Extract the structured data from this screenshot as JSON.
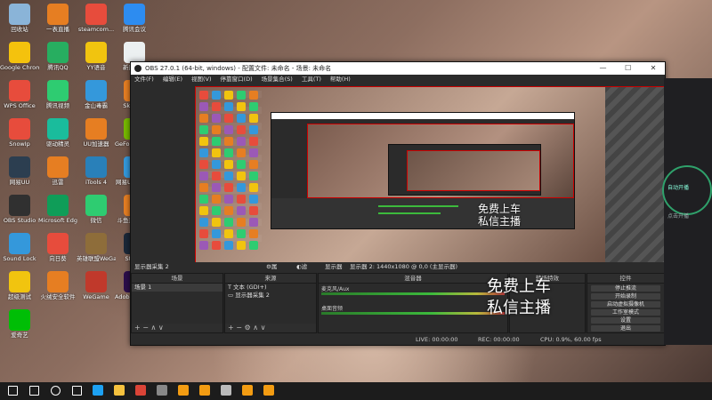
{
  "desktop_icons": [
    {
      "label": "回收站",
      "icon": "recycle-bin-icon",
      "color": "#8ab4d8"
    },
    {
      "label": "一表直播",
      "icon": "app-icon",
      "color": "#e67e22"
    },
    {
      "label": "steamcom...",
      "icon": "steam-icon",
      "color": "#e74c3c"
    },
    {
      "label": "腾讯会议",
      "icon": "meeting-icon",
      "color": "#2d8cf0"
    },
    {
      "label": "Google Chrome",
      "icon": "chrome-icon",
      "color": "#f4c20d"
    },
    {
      "label": "腾讯QQ",
      "icon": "qq-icon",
      "color": "#27ae60"
    },
    {
      "label": "YY语音",
      "icon": "yy-icon",
      "color": "#f1c40f"
    },
    {
      "label": "新建文本",
      "icon": "file-icon",
      "color": "#ecf0f1"
    },
    {
      "label": "WPS Office",
      "icon": "wps-icon",
      "color": "#e74c3c"
    },
    {
      "label": "腾讯视频",
      "icon": "video-icon",
      "color": "#2ecc71"
    },
    {
      "label": "金山毒霸",
      "icon": "security-icon",
      "color": "#3498db"
    },
    {
      "label": "SkyDisk",
      "icon": "app-icon",
      "color": "#e67e22"
    },
    {
      "label": "SnowIp",
      "icon": "app-icon",
      "color": "#e74c3c"
    },
    {
      "label": "驱动精灵",
      "icon": "app-icon",
      "color": "#1abc9c"
    },
    {
      "label": "UU加速器",
      "icon": "app-icon",
      "color": "#e67e22"
    },
    {
      "label": "GeForce Experience",
      "icon": "nvidia-icon",
      "color": "#76b900"
    },
    {
      "label": "网易UU",
      "icon": "app-icon",
      "color": "#2c3e50"
    },
    {
      "label": "迅雷",
      "icon": "app-icon",
      "color": "#e67e22"
    },
    {
      "label": "iTools 4",
      "icon": "itools-icon",
      "color": "#2980b9"
    },
    {
      "label": "网易UU加速器",
      "icon": "app-icon",
      "color": "#3498db"
    },
    {
      "label": "OBS Studio",
      "icon": "obs-icon",
      "color": "#303030"
    },
    {
      "label": "Microsoft Edge",
      "icon": "edge-icon",
      "color": "#0f9d58"
    },
    {
      "label": "微信",
      "icon": "wechat-icon",
      "color": "#2ecc71"
    },
    {
      "label": "斗鱼直播伴侣",
      "icon": "app-icon",
      "color": "#e67e22"
    },
    {
      "label": "Sound Lock",
      "icon": "lock-icon",
      "color": "#3498db"
    },
    {
      "label": "向日葵",
      "icon": "app-icon",
      "color": "#e74c3c"
    },
    {
      "label": "英雄联盟WeGame版",
      "icon": "game-icon",
      "color": "#8e6d3a"
    },
    {
      "label": "Steam",
      "icon": "steam-icon",
      "color": "#1b2838"
    },
    {
      "label": "超级测试",
      "icon": "app-icon",
      "color": "#f1c40f"
    },
    {
      "label": "火绒安全软件",
      "icon": "shield-icon",
      "color": "#e67e22"
    },
    {
      "label": "WeGame",
      "icon": "wegame-icon",
      "color": "#c0392b"
    },
    {
      "label": "Adobe Premie...",
      "icon": "premiere-icon",
      "color": "#2c0e4a"
    },
    {
      "label": "爱奇艺",
      "icon": "iqiyi-icon",
      "color": "#00be06"
    }
  ],
  "obs": {
    "title": "OBS 27.0.1 (64-bit, windows) - 配置文件: 未命名 - 场景: 未命名",
    "menu": [
      "文件(F)",
      "编辑(E)",
      "视图(V)",
      "停靠窗口(D)",
      "场景集合(S)",
      "工具(T)",
      "帮助(H)"
    ],
    "info_bar": {
      "source": "显示器采集 2",
      "properties": "属性",
      "filters": "滤镜",
      "display_label": "显示器",
      "display_value": "显示器 2: 1440x1080 @ 0,0 (主显示器)"
    },
    "docks": {
      "scenes": {
        "title": "场景",
        "items": [
          "场景 1"
        ]
      },
      "sources": {
        "title": "来源",
        "items": [
          "文本 (GDI+)",
          "显示器采集 2"
        ]
      },
      "mixer": {
        "title": "混音器",
        "tracks": [
          {
            "name": "桌面音频",
            "value": "0.0 dB"
          },
          {
            "name": "麦克风/Aux",
            "value": "0.0 dB"
          }
        ]
      },
      "transitions": {
        "title": "转场特效",
        "type": "淡出",
        "duration_label": "时长",
        "duration": "300 ms"
      },
      "controls": {
        "title": "控件",
        "buttons": [
          "停止推流",
          "开始录制",
          "启动虚拟摄像机",
          "工作室模式",
          "设置",
          "退出"
        ]
      }
    },
    "status": {
      "live": "LIVE: 00:00:00",
      "rec": "REC: 00:00:00",
      "cpu": "CPU: 0.9%, 60.00 fps"
    }
  },
  "overlay": {
    "line1": "免费上车",
    "line2": "私信主播"
  },
  "right_window": {
    "start_label": "自动开播",
    "hint": "点击开播"
  },
  "taskbar": [
    "start",
    "search",
    "cortana",
    "task-view",
    "edge",
    "explorer",
    "chrome",
    "obs",
    "app",
    "app",
    "settings",
    "app",
    "app"
  ]
}
